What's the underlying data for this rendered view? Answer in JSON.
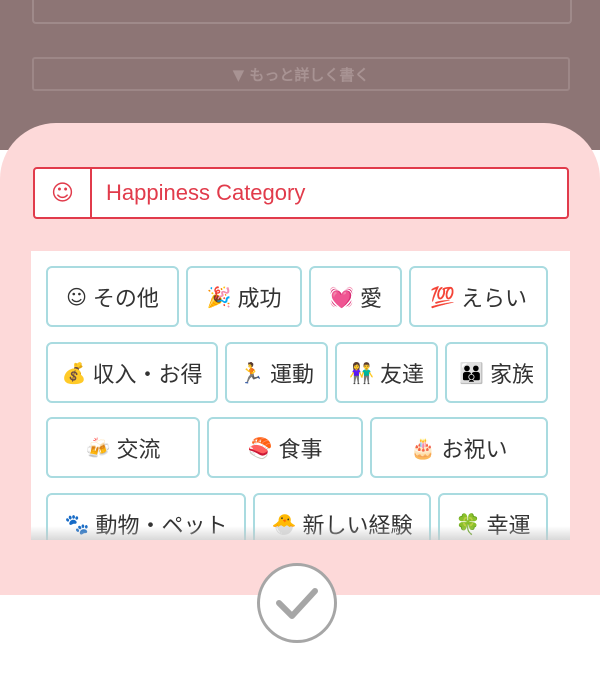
{
  "background": {
    "more_button_label": "▼ もっと詳しく書く"
  },
  "sheet": {
    "header_icon": "☺",
    "title": "Happiness Category"
  },
  "categories": [
    {
      "icon": "☺",
      "icon_name": "smile-icon",
      "label": "その他"
    },
    {
      "icon": "🎉",
      "icon_name": "party-popper-icon",
      "label": "成功"
    },
    {
      "icon": "💓",
      "icon_name": "heart-icon",
      "label": "愛"
    },
    {
      "icon": "💯",
      "icon_name": "hundred-icon",
      "label": "えらい"
    },
    {
      "icon": "💰",
      "icon_name": "money-bag-icon",
      "label": "収入・お得"
    },
    {
      "icon": "🏃",
      "icon_name": "runner-icon",
      "label": "運動"
    },
    {
      "icon": "👫",
      "icon_name": "friends-icon",
      "label": "友達"
    },
    {
      "icon": "👪",
      "icon_name": "family-icon",
      "label": "家族"
    },
    {
      "icon": "🍻",
      "icon_name": "beer-cheers-icon",
      "label": "交流"
    },
    {
      "icon": "🍣",
      "icon_name": "sushi-icon",
      "label": "食事"
    },
    {
      "icon": "🎂",
      "icon_name": "birthday-cake-icon",
      "label": "お祝い"
    },
    {
      "icon": "🐾",
      "icon_name": "paw-prints-icon",
      "label": "動物・ペット"
    },
    {
      "icon": "🐣",
      "icon_name": "hatching-chick-icon",
      "label": "新しい経験"
    },
    {
      "icon": "🍀",
      "icon_name": "four-leaf-clover-icon",
      "label": "幸運"
    }
  ],
  "colors": {
    "accent": "#e13b4b",
    "sheet": "#fdd9d9",
    "chip_border": "#a9dbe0",
    "backdrop": "#8d7575"
  }
}
